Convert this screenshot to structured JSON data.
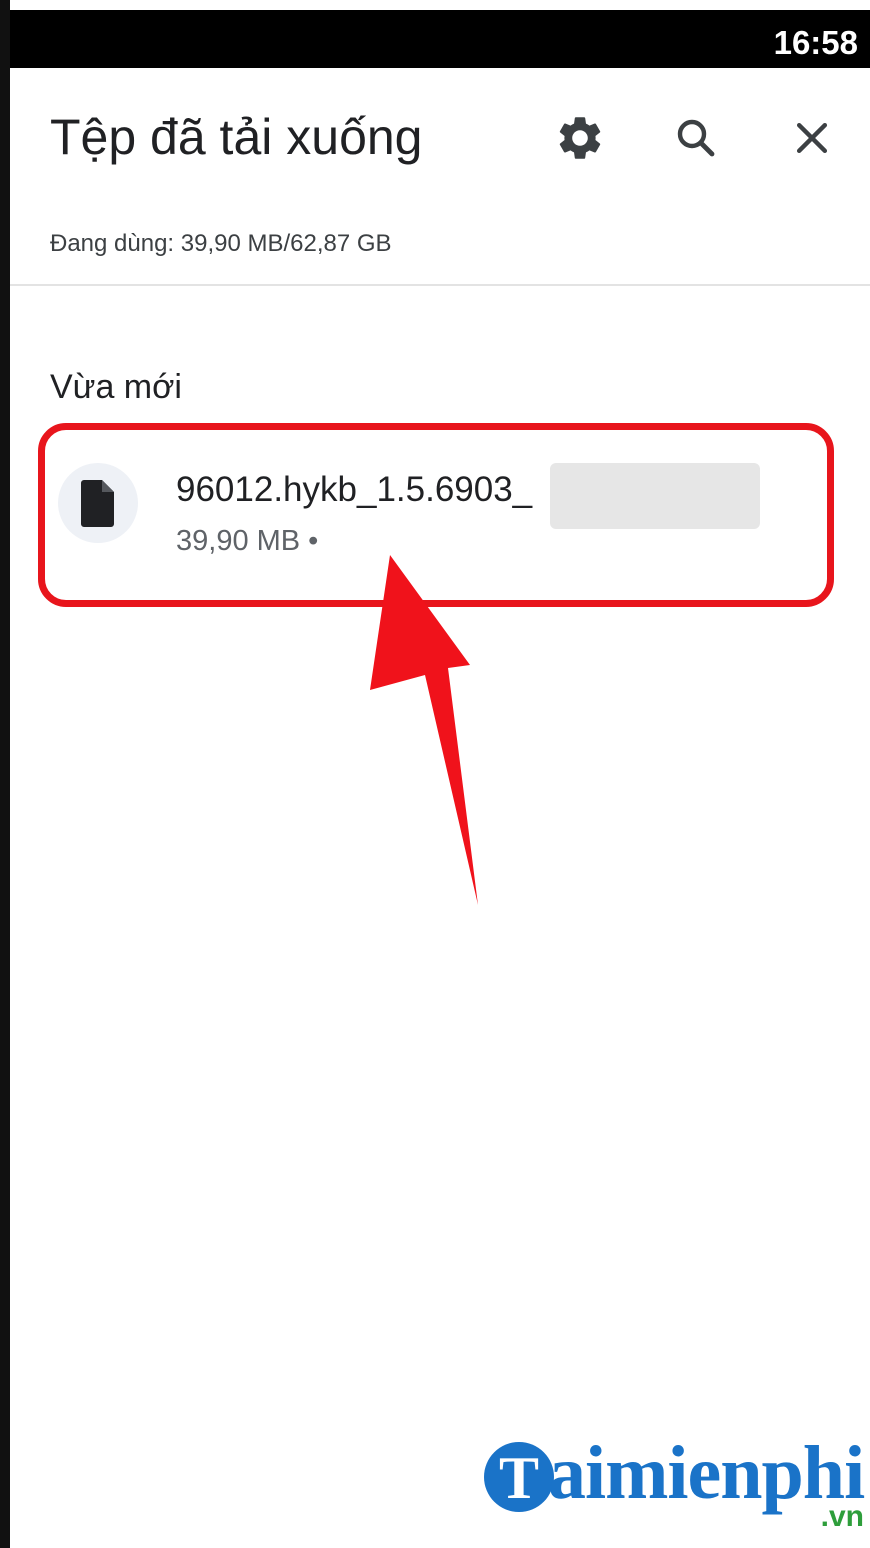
{
  "status_bar": {
    "time": "16:58"
  },
  "header": {
    "title": "Tệp đã tải xuống",
    "icons": [
      "settings-icon",
      "search-icon",
      "close-icon"
    ]
  },
  "storage": {
    "text": "Đang dùng: 39,90 MB/62,87 GB"
  },
  "section": {
    "label": "Vừa mới"
  },
  "file": {
    "name": "96012.hykb_1.5.6903_",
    "meta": "39,90 MB •",
    "icon": "file-icon"
  },
  "annotation": {
    "highlight_color": "#e8151c",
    "arrow_color": "#f0121b"
  },
  "watermark": {
    "main": "aimienphi",
    "suffix": ".vn",
    "brand_color": "#1a73c8"
  }
}
